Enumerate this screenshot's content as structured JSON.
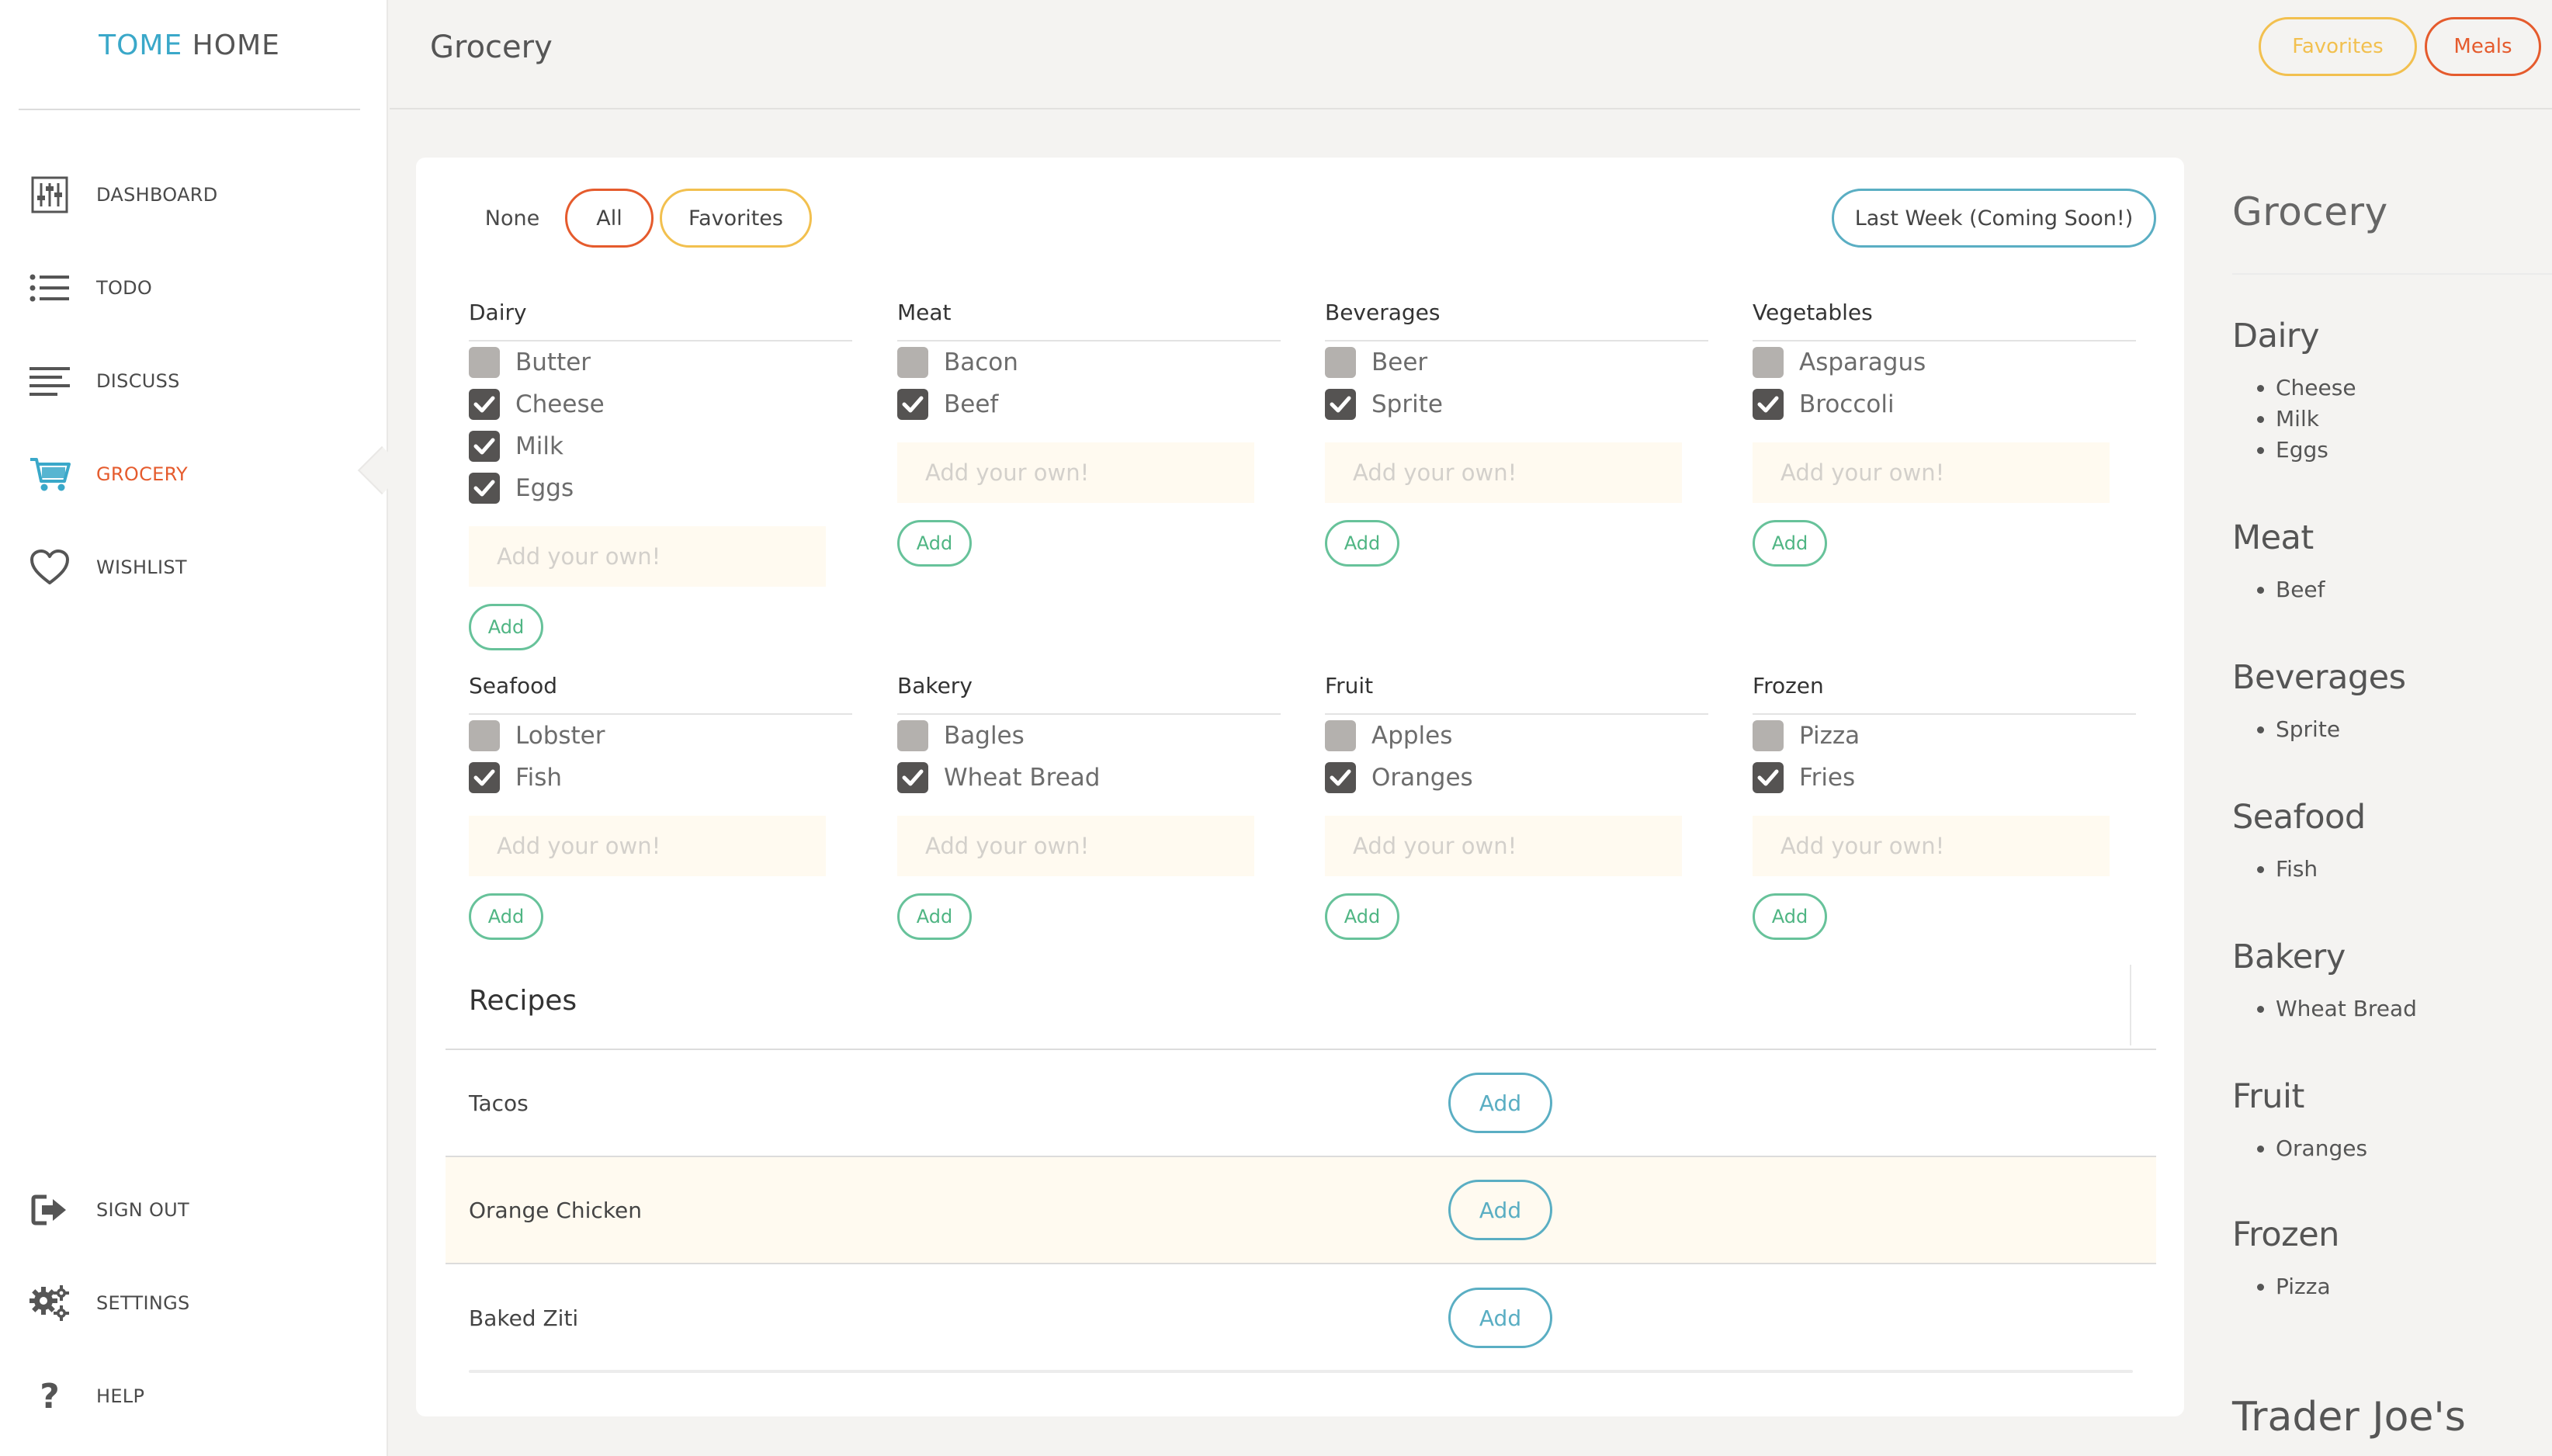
{
  "brand": {
    "part1": "TOME",
    "part2": " HOME"
  },
  "nav": [
    {
      "label": "DASHBOARD",
      "icon": "dashboard-sliders-icon"
    },
    {
      "label": "TODO",
      "icon": "list-icon"
    },
    {
      "label": "DISCUSS",
      "icon": "lines-icon"
    },
    {
      "label": "GROCERY",
      "icon": "cart-icon",
      "active": true
    },
    {
      "label": "WISHLIST",
      "icon": "heart-icon"
    },
    {
      "label": "SIGN OUT",
      "icon": "sign-out-icon"
    },
    {
      "label": "SETTINGS",
      "icon": "gears-icon"
    },
    {
      "label": "HELP",
      "icon": "question-icon"
    }
  ],
  "header": {
    "title": "Grocery",
    "favorites": "Favorites",
    "meals": "Meals"
  },
  "filters": {
    "none": "None",
    "all": "All",
    "favorites": "Favorites",
    "last_week": "Last Week (Coming Soon!)"
  },
  "add_placeholder": "Add your own!",
  "add_label": "Add",
  "categories": [
    {
      "title": "Dairy",
      "items": [
        {
          "label": "Butter",
          "checked": false
        },
        {
          "label": "Cheese",
          "checked": true
        },
        {
          "label": "Milk",
          "checked": true
        },
        {
          "label": "Eggs",
          "checked": true
        }
      ]
    },
    {
      "title": "Meat",
      "items": [
        {
          "label": "Bacon",
          "checked": false
        },
        {
          "label": "Beef",
          "checked": true
        }
      ]
    },
    {
      "title": "Beverages",
      "items": [
        {
          "label": "Beer",
          "checked": false
        },
        {
          "label": "Sprite",
          "checked": true
        }
      ]
    },
    {
      "title": "Vegetables",
      "items": [
        {
          "label": "Asparagus",
          "checked": false
        },
        {
          "label": "Broccoli",
          "checked": true
        }
      ]
    },
    {
      "title": "Seafood",
      "items": [
        {
          "label": "Lobster",
          "checked": false
        },
        {
          "label": "Fish",
          "checked": true
        }
      ]
    },
    {
      "title": "Bakery",
      "items": [
        {
          "label": "Bagles",
          "checked": false
        },
        {
          "label": "Wheat Bread",
          "checked": true
        }
      ]
    },
    {
      "title": "Fruit",
      "items": [
        {
          "label": "Apples",
          "checked": false
        },
        {
          "label": "Oranges",
          "checked": true
        }
      ]
    },
    {
      "title": "Frozen",
      "items": [
        {
          "label": "Pizza",
          "checked": false
        },
        {
          "label": "Fries",
          "checked": true
        }
      ]
    }
  ],
  "recipes": {
    "title": "Recipes",
    "add_label": "Add",
    "rows": [
      {
        "name": "Tacos"
      },
      {
        "name": "Orange Chicken"
      },
      {
        "name": "Baked Ziti"
      }
    ]
  },
  "summary": {
    "title": "Grocery",
    "sections": [
      {
        "title": "Dairy",
        "items": [
          "Cheese",
          "Milk",
          "Eggs"
        ]
      },
      {
        "title": "Meat",
        "items": [
          "Beef"
        ]
      },
      {
        "title": "Beverages",
        "items": [
          "Sprite"
        ]
      },
      {
        "title": "Seafood",
        "items": [
          "Fish"
        ]
      },
      {
        "title": "Bakery",
        "items": [
          "Wheat Bread"
        ]
      },
      {
        "title": "Fruit",
        "items": [
          "Oranges"
        ]
      },
      {
        "title": "Frozen",
        "items": [
          "Pizza"
        ]
      }
    ],
    "store": "Trader Joe's"
  },
  "colors": {
    "accent_orange": "#e55b2d",
    "accent_yellow": "#f2c04f",
    "accent_teal": "#5aaec3",
    "accent_green": "#67c29a",
    "brand_blue": "#3aa8c9"
  }
}
